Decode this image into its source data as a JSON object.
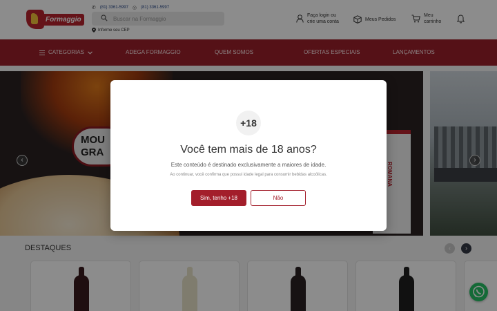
{
  "header": {
    "logo_text": "Formaggio",
    "phone_1": "(81) 3361-5997",
    "phone_2": "(81) 3361-5997",
    "search_placeholder": "Buscar na Formaggio",
    "cep_label": "Informe seu CEP",
    "login_line1": "Faça login ou",
    "login_line2": "crie uma conta",
    "orders_label": "Meus Pedidos",
    "cart_line1": "Meu",
    "cart_line2": "carrinho"
  },
  "nav": {
    "items": [
      "CATEGORIAS",
      "ADEGA FORMAGGIO",
      "QUEM SOMOS",
      "OFERTAS ESPECIAIS",
      "LANÇAMENTOS"
    ]
  },
  "hero": {
    "sign_text": "MOU GRA",
    "bag_text": "ROMANA"
  },
  "destaques": {
    "title": "DESTAQUES"
  },
  "modal": {
    "badge": "+18",
    "title": "Você tem mais de 18 anos?",
    "text": "Este conteúdo é destinado exclusivamente a maiores de idade.",
    "small": "Ao continuar, você confirma que possui idade legal para consumir bebidas alcoólicas.",
    "yes_label": "Sim, tenho +18",
    "no_label": "Não"
  },
  "colors": {
    "brand_red": "#9c1f2a",
    "button_red": "#a31e2b",
    "whatsapp_green": "#25c264"
  }
}
